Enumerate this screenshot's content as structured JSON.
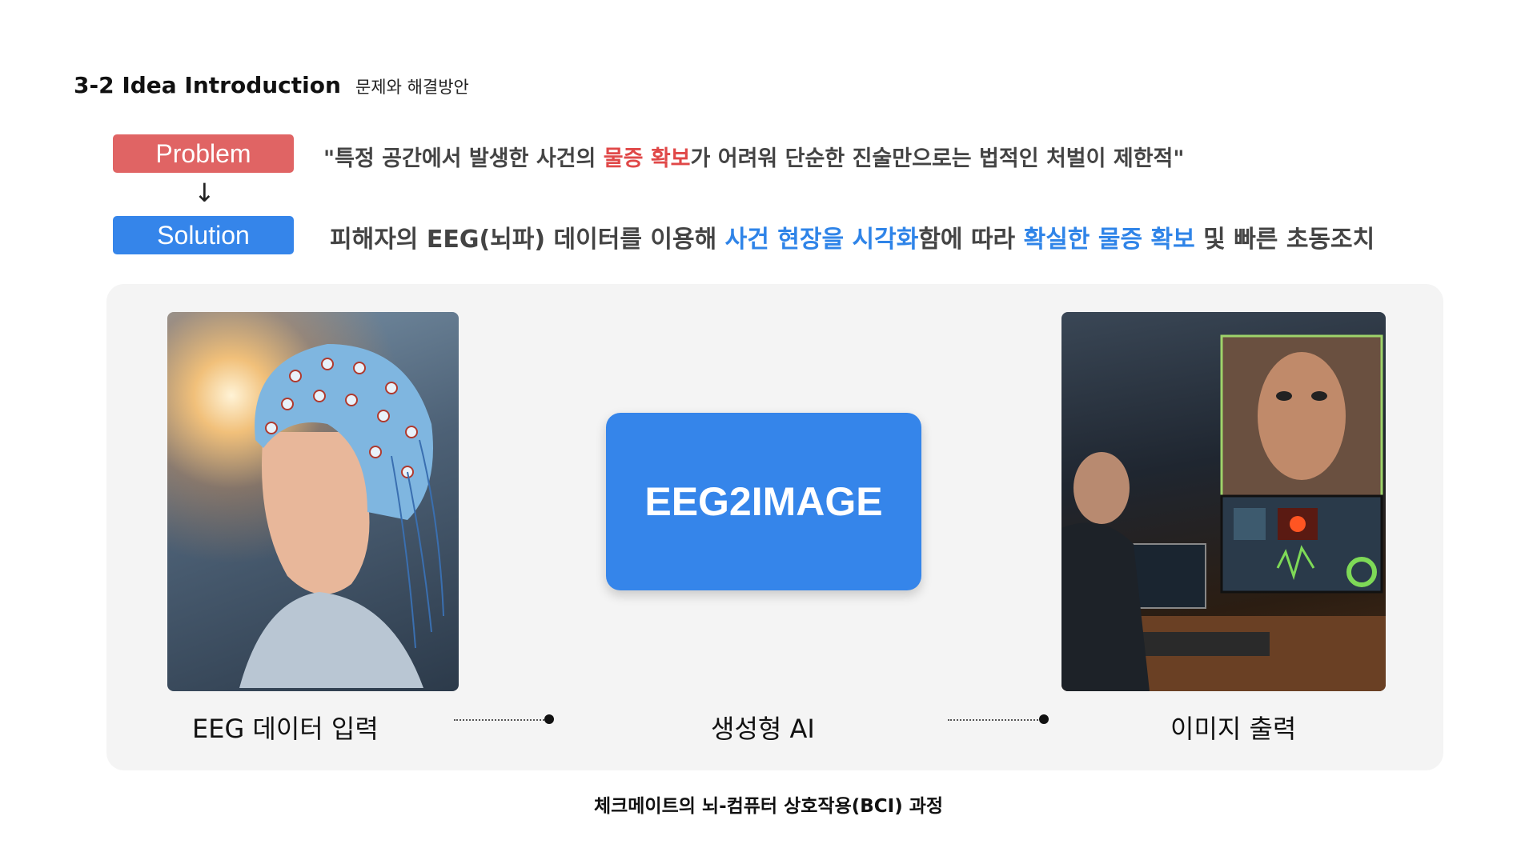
{
  "header": {
    "title": "3-2  Idea Introduction",
    "subtitle": "문제와 해결방안"
  },
  "problem": {
    "tag": "Problem",
    "text_1": "\"특정 공간에서 발생한 사건의 ",
    "highlight_1": "물증 확보",
    "text_2": "가 어려워 단순한 진술만으로는 법적인 처벌이 제한적\""
  },
  "arrow": "↓",
  "solution": {
    "tag": "Solution",
    "text_1": "피해자의 EEG(뇌파) 데이터를 이용해 ",
    "highlight_1": "사건 현장을 시각화",
    "text_2": "함에 따라 ",
    "highlight_2": "확실한 물증 확보",
    "text_3": " 및 빠른 초동조치"
  },
  "flow": {
    "input_label": "EEG 데이터 입력",
    "ai_box": "EEG2IMAGE",
    "ai_label": "생성형 AI",
    "output_label": "이미지 출력"
  },
  "footer": "체크메이트의 뇌-컴퓨터 상호작용(BCI) 과정",
  "colors": {
    "problem": "#e06464",
    "solution": "#3585ea",
    "highlight_red": "#e04848",
    "highlight_blue": "#2f84e8"
  }
}
